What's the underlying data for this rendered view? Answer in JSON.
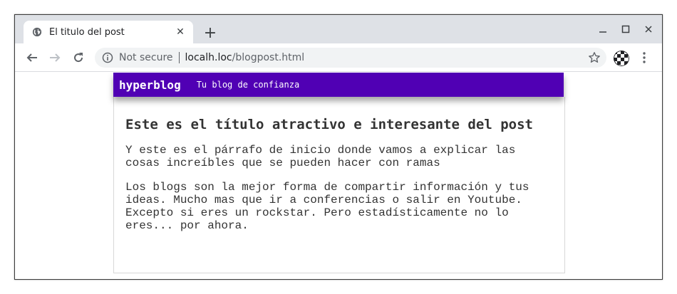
{
  "browser": {
    "tab_title": "El titulo del post",
    "tab_close": "✕",
    "new_tab": "+",
    "security_label": "Not secure",
    "url_host": "localh.loc",
    "url_path": "/blogpost.html"
  },
  "blog": {
    "brand": "hyperblog",
    "tagline": "Tu blog de confianza",
    "header_color": "#5000b4"
  },
  "post": {
    "title": "Este es el título atractivo e interesante del post",
    "intro": "Y este es el párrafo de inicio donde vamos a explicar las cosas increíbles que se pueden hacer con ramas",
    "body": "Los blogs son la mejor forma de compartir información y tus ideas. Mucho mas que ir a conferencias o salir en Youtube. Excepto si eres un rockstar. Pero estadísticamente no lo eres... por ahora."
  },
  "icons": {
    "tab_favicon": "globe-icon",
    "back": "back-arrow-icon",
    "forward": "forward-arrow-icon",
    "reload": "reload-icon",
    "info": "info-icon",
    "bookmark": "star-icon",
    "profile": "avatar",
    "menu": "kebab-menu-icon"
  }
}
